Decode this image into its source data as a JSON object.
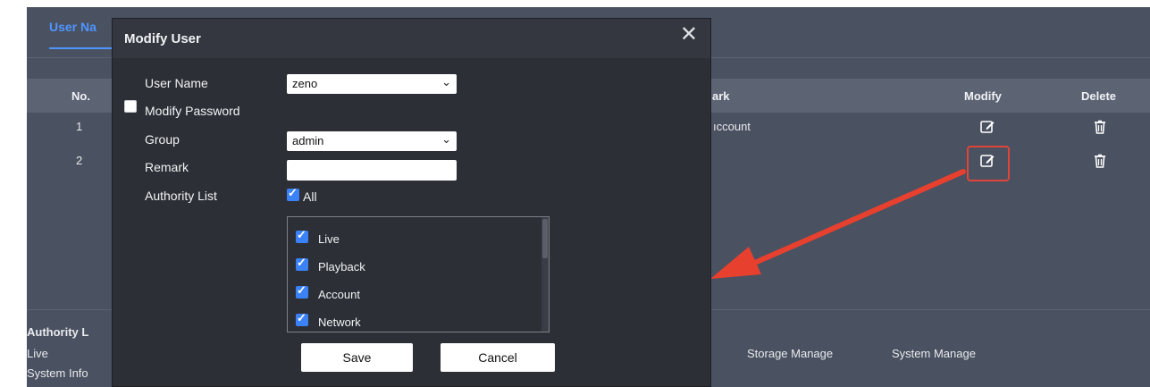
{
  "background": {
    "tab_label": "User Na",
    "table": {
      "headers": {
        "no": "No.",
        "remark": "ark",
        "modify": "Modify",
        "delete": "Delete"
      },
      "rows": [
        {
          "no": "1",
          "remark": "ıccount"
        },
        {
          "no": "2",
          "remark": ""
        }
      ]
    },
    "authority": {
      "title": "Authority L",
      "items": [
        "Live",
        "System Info",
        "Storage Manage",
        "System Manage"
      ],
      "live": "Live",
      "system_info": "System Info",
      "storage_manage": "Storage Manage",
      "system_manage": "System Manage"
    },
    "colors": {
      "highlight": "#e0453a",
      "tab_accent": "#4f95ff"
    }
  },
  "modal": {
    "title": "Modify User",
    "close_glyph": "✕",
    "user_name_label": "User Name",
    "user_name_value": "zeno",
    "modify_password_label": "Modify Password",
    "modify_password_checked": false,
    "group_label": "Group",
    "group_value": "admin",
    "remark_label": "Remark",
    "remark_value": "",
    "authority_label": "Authority List",
    "all_label": "All",
    "all_checked": true,
    "authority_items": [
      {
        "label": "Live",
        "checked": true
      },
      {
        "label": "Playback",
        "checked": true
      },
      {
        "label": "Account",
        "checked": true
      },
      {
        "label": "Network",
        "checked": true
      }
    ],
    "save_label": "Save",
    "cancel_label": "Cancel"
  }
}
